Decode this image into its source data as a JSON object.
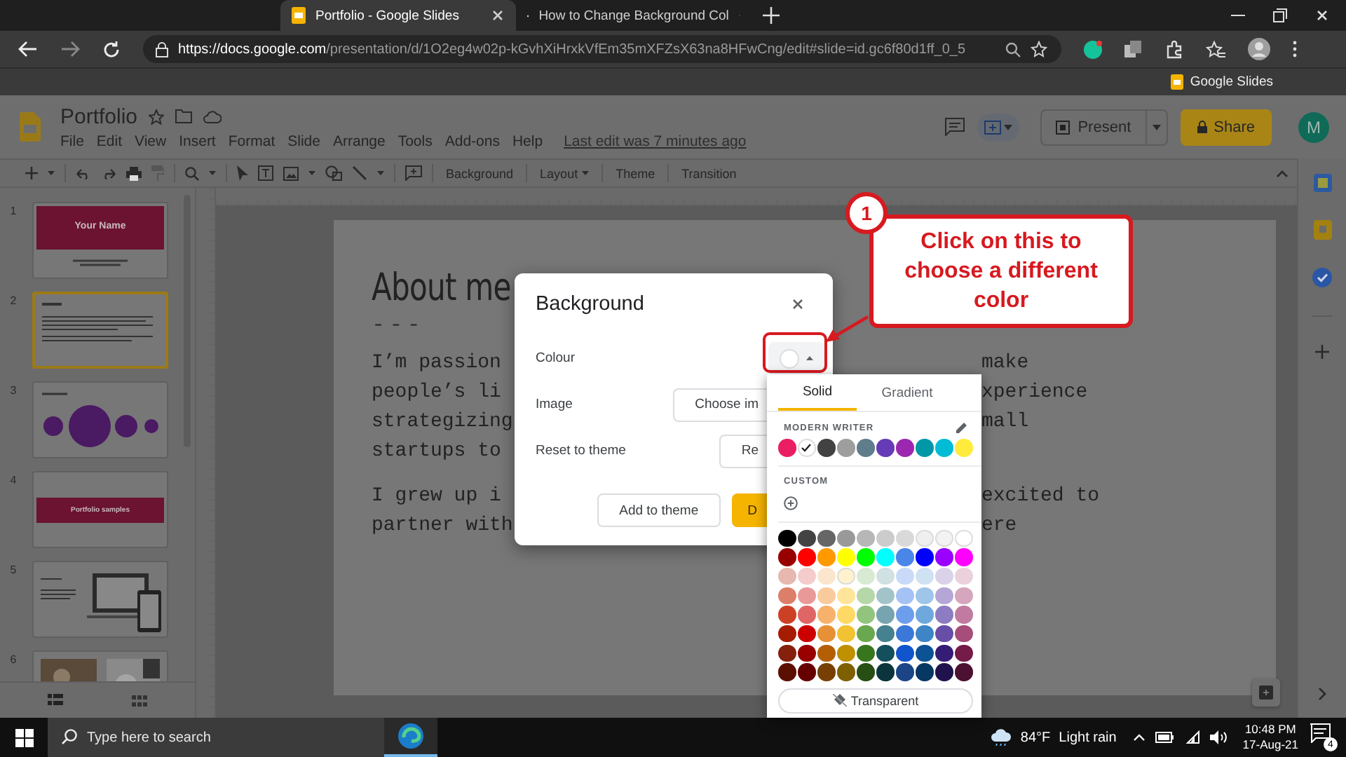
{
  "browser": {
    "tabs": [
      {
        "title": "Portfolio - Google Slides",
        "selected": true
      },
      {
        "title": "How to Change Background Col",
        "selected": false
      }
    ],
    "url": {
      "host": "https://docs.google.com",
      "path": "/presentation/d/1O2eg4w02p-kGvhXiHrxkVfEm35mXFZsX63na8HFwCng/edit#slide=id.gc6f80d1ff_0_5"
    },
    "bookmarks": [
      "Google Slides"
    ]
  },
  "app": {
    "title": "Portfolio",
    "menu": [
      "File",
      "Edit",
      "View",
      "Insert",
      "Format",
      "Slide",
      "Arrange",
      "Tools",
      "Add-ons",
      "Help"
    ],
    "last_edit": "Last edit was 7 minutes ago",
    "present": "Present",
    "share": "Share",
    "avatar": "M"
  },
  "toolbar": {
    "buttons": [
      {
        "label": "Background",
        "dropdown": false
      },
      {
        "label": "Layout",
        "dropdown": true
      },
      {
        "label": "Theme",
        "dropdown": false
      },
      {
        "label": "Transition",
        "dropdown": false
      }
    ]
  },
  "filmstrip": [
    {
      "number": "1",
      "kind": "title",
      "title": "Your Name",
      "selected": false
    },
    {
      "number": "2",
      "kind": "text",
      "selected": true
    },
    {
      "number": "3",
      "kind": "circles",
      "selected": false
    },
    {
      "number": "4",
      "kind": "band",
      "title": "Portfolio samples",
      "selected": false
    },
    {
      "number": "5",
      "kind": "device",
      "selected": false
    },
    {
      "number": "6",
      "kind": "photos",
      "selected": false
    }
  ],
  "slide": {
    "title": "About me",
    "rule": "---",
    "paragraphs": [
      [
        {
          "left": "I’m passion",
          "right": "make"
        },
        {
          "left": "people’s li",
          "right": "xperience"
        },
        {
          "left": "strategizing",
          "right": "mall"
        },
        {
          "left": "startups to"
        }
      ],
      [
        {
          "left": "I grew up i",
          "right": "excited to"
        },
        {
          "left": "partner with",
          "right": "ere"
        }
      ]
    ]
  },
  "dialog": {
    "title": "Background",
    "rows": [
      {
        "label": "Colour",
        "kind": "swatch"
      },
      {
        "label": "Image",
        "kind": "button",
        "button": "Choose im"
      },
      {
        "label": "Reset to theme",
        "kind": "button",
        "button": "Re"
      }
    ],
    "actions": [
      {
        "label": "Add to theme",
        "primary": false
      },
      {
        "label": "D",
        "primary": true
      }
    ]
  },
  "picker": {
    "tabs": [
      {
        "label": "Solid",
        "selected": true
      },
      {
        "label": "Gradient",
        "selected": false
      }
    ],
    "theme_label": "MODERN WRITER",
    "theme_colors": [
      {
        "color": "#e91e63",
        "selected": false
      },
      {
        "color": "#ffffff",
        "selected": true
      },
      {
        "color": "#424242",
        "selected": false
      },
      {
        "color": "#9e9e9e",
        "selected": false
      },
      {
        "color": "#607d8b",
        "selected": false
      },
      {
        "color": "#673ab7",
        "selected": false
      },
      {
        "color": "#9c27b0",
        "selected": false
      },
      {
        "color": "#0097a7",
        "selected": false
      },
      {
        "color": "#00bcd4",
        "selected": false
      },
      {
        "color": "#ffeb3b",
        "selected": false
      }
    ],
    "custom_label": "CUSTOM",
    "palette": [
      [
        {
          "color": "#000000"
        },
        {
          "color": "#434343"
        },
        {
          "color": "#666666"
        },
        {
          "color": "#999999"
        },
        {
          "color": "#b7b7b7"
        },
        {
          "color": "#cccccc"
        },
        {
          "color": "#d9d9d9"
        },
        {
          "color": "#efefef"
        },
        {
          "color": "#f3f3f3"
        },
        {
          "color": "#ffffff"
        }
      ],
      [
        {
          "color": "#980000"
        },
        {
          "color": "#ff0000"
        },
        {
          "color": "#ff9900"
        },
        {
          "color": "#ffff00"
        },
        {
          "color": "#00ff00"
        },
        {
          "color": "#00ffff"
        },
        {
          "color": "#4a86e8"
        },
        {
          "color": "#0000ff"
        },
        {
          "color": "#9900ff"
        },
        {
          "color": "#ff00ff"
        }
      ],
      [
        {
          "color": "#e6b8af"
        },
        {
          "color": "#f4cccc"
        },
        {
          "color": "#fce5cd"
        },
        {
          "color": "#fff2cc"
        },
        {
          "color": "#d9ead3"
        },
        {
          "color": "#d0e0e3"
        },
        {
          "color": "#c9daf8"
        },
        {
          "color": "#cfe2f3"
        },
        {
          "color": "#d9d2e9"
        },
        {
          "color": "#ead1dc"
        }
      ],
      [
        {
          "color": "#dd7e6b"
        },
        {
          "color": "#ea9999"
        },
        {
          "color": "#f9cb9c"
        },
        {
          "color": "#ffe599"
        },
        {
          "color": "#b6d7a8"
        },
        {
          "color": "#a2c4c9"
        },
        {
          "color": "#a4c2f4"
        },
        {
          "color": "#9fc5e8"
        },
        {
          "color": "#b4a7d6"
        },
        {
          "color": "#d5a6bd"
        }
      ],
      [
        {
          "color": "#cc4125"
        },
        {
          "color": "#e06666"
        },
        {
          "color": "#f6b26b"
        },
        {
          "color": "#ffd966"
        },
        {
          "color": "#93c47d"
        },
        {
          "color": "#76a5af"
        },
        {
          "color": "#6d9eeb"
        },
        {
          "color": "#6fa8dc"
        },
        {
          "color": "#8e7cc3"
        },
        {
          "color": "#c27ba0"
        }
      ],
      [
        {
          "color": "#a61c00"
        },
        {
          "color": "#cc0000"
        },
        {
          "color": "#e69138"
        },
        {
          "color": "#f1c232"
        },
        {
          "color": "#6aa84f"
        },
        {
          "color": "#45818e"
        },
        {
          "color": "#3c78d8"
        },
        {
          "color": "#3d85c6"
        },
        {
          "color": "#674ea7"
        },
        {
          "color": "#a64d79"
        }
      ],
      [
        {
          "color": "#85200c"
        },
        {
          "color": "#990000"
        },
        {
          "color": "#b45f06"
        },
        {
          "color": "#bf9000"
        },
        {
          "color": "#38761d"
        },
        {
          "color": "#134f5c"
        },
        {
          "color": "#1155cc"
        },
        {
          "color": "#0b5394"
        },
        {
          "color": "#351c75"
        },
        {
          "color": "#741b47"
        }
      ],
      [
        {
          "color": "#5b0f00"
        },
        {
          "color": "#660000"
        },
        {
          "color": "#783f04"
        },
        {
          "color": "#7f6000"
        },
        {
          "color": "#274e13"
        },
        {
          "color": "#0c343d"
        },
        {
          "color": "#1c4587"
        },
        {
          "color": "#073763"
        },
        {
          "color": "#20124d"
        },
        {
          "color": "#4c1130"
        }
      ]
    ],
    "transparent": "Transparent"
  },
  "callout": {
    "step": "1",
    "text": "Click on this to choose a different color"
  },
  "taskbar": {
    "placeholder": "Type here to search",
    "temperature": "84°F",
    "weather": "Light rain",
    "time": "10:48 PM",
    "date": "17-Aug-21",
    "notifications": "4"
  }
}
